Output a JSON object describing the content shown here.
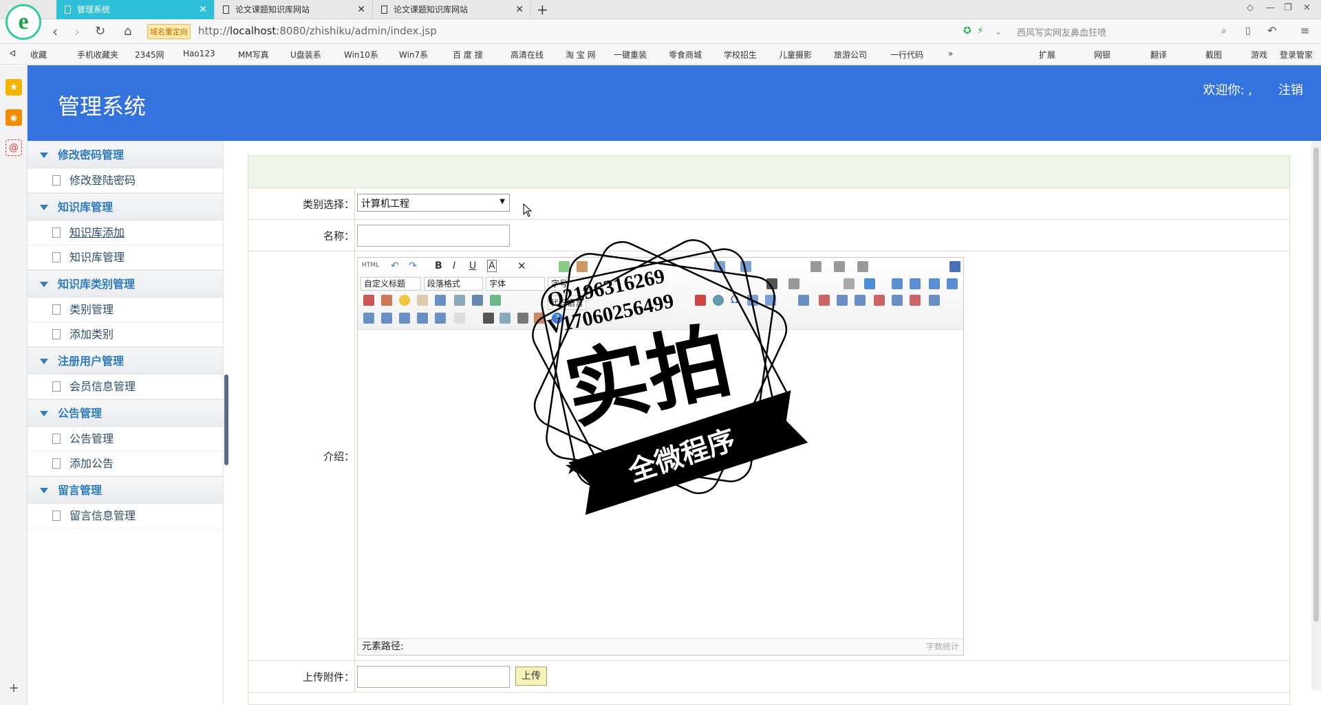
{
  "browser": {
    "tabs": [
      {
        "label": "管理系统",
        "active": true
      },
      {
        "label": "论文课题知识库网站",
        "active": false
      },
      {
        "label": "论文课题知识库网站",
        "active": false
      }
    ],
    "redirect_badge": "域名重定向",
    "url_prefix": "http://",
    "url_host": "localhost",
    "url_rest": ":8080/zhishiku/admin/index.jsp",
    "search_placeholder": "西风写实网友鼻血狂喷",
    "bookmarks": [
      "收藏",
      "手机收藏夹",
      "2345网",
      "Hao123",
      "MM写真",
      "U盘装系",
      "Win10系",
      "Win7系",
      "百 度 搜",
      "高清在线",
      "淘 宝 网",
      "一键重装",
      "零食商城",
      "学校招生",
      "儿童摄影",
      "旅游公司",
      "一行代码",
      "»"
    ],
    "right_tools": [
      "扩展",
      "网银",
      "翻译",
      "截图",
      "游戏",
      "登录管家"
    ]
  },
  "app": {
    "title": "管理系统",
    "welcome": "欢迎你: ,",
    "logout": "注销"
  },
  "menu": [
    {
      "group": "修改密码管理",
      "items": [
        "修改登陆密码"
      ]
    },
    {
      "group": "知识库管理",
      "items": [
        "知识库添加",
        "知识库管理"
      ]
    },
    {
      "group": "知识库类别管理",
      "items": [
        "类别管理",
        "添加类别"
      ]
    },
    {
      "group": "注册用户管理",
      "items": [
        "会员信息管理"
      ]
    },
    {
      "group": "公告管理",
      "items": [
        "公告管理",
        "添加公告"
      ]
    },
    {
      "group": "留言管理",
      "items": [
        "留言信息管理"
      ]
    }
  ],
  "form": {
    "category_label": "类别选择：",
    "category_value": "计算机工程",
    "name_label": "名称：",
    "intro_label": "介绍：",
    "upload_label": "上传附件：",
    "upload_button": "上传"
  },
  "editor": {
    "html_btn": "HTML",
    "title_dd": "自定义标题",
    "para_dd": "段落格式",
    "font_dd": "字体",
    "size_dd": "字号",
    "code_lang": "代码语言",
    "path_label": "元素路径:",
    "word_count": "字数统计"
  },
  "watermark": {
    "line1": "Q2196316269",
    "line2": "V17060256499",
    "big": "实拍",
    "ribbon": "全微程序"
  }
}
